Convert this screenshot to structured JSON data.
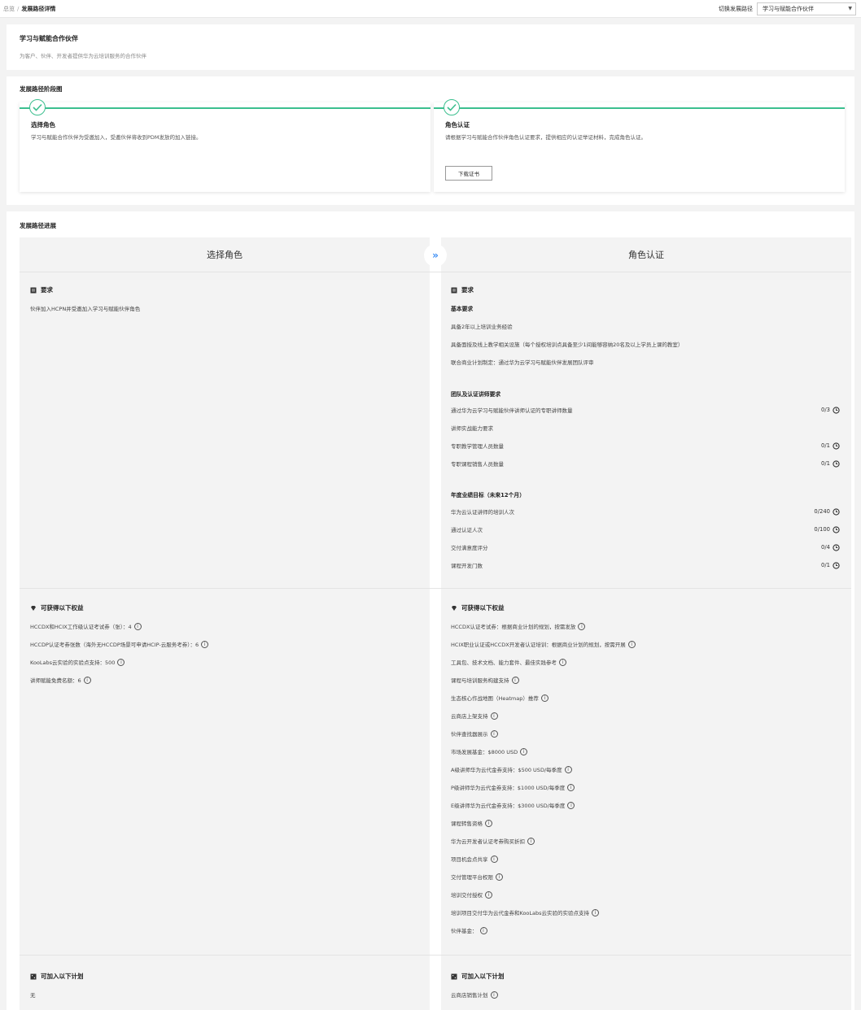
{
  "breadcrumb": {
    "root": "总览",
    "sep": "/",
    "current": "发展路径详情"
  },
  "switcher": {
    "label": "切换发展路径",
    "selected": "学习与赋能合作伙伴"
  },
  "header": {
    "title": "学习与赋能合作伙伴",
    "desc": "为客户、伙伴、开发者提供华为云培训服务的合作伙伴"
  },
  "stage_map": {
    "title": "发展路径阶段图",
    "stages": [
      {
        "title": "选择角色",
        "desc": "学习与赋能合作伙伴为受邀加入，受邀伙伴将收到PDM发放的加入链接。"
      },
      {
        "title": "角色认证",
        "desc": "请根据学习与赋能合作伙伴角色认证要求，提供相应的认证举证材料，完成角色认证。",
        "button": "下载证书"
      }
    ]
  },
  "progress": {
    "title": "发展路径进展",
    "left_col": "选择角色",
    "right_col": "角色认证",
    "requirements_title": "要求",
    "left_requirements": [
      "伙伴加入HCPN并受邀加入学习与赋能伙伴角色"
    ],
    "right_requirements": {
      "basic_title": "基本要求",
      "basic": [
        "具备2年以上培训业务经验",
        "具备面授及线上教学相关设施（每个授权培训点具备至少1间能够容纳20名及以上学员上课的教室）",
        "联合商业计划制定：通过华为云学习与赋能伙伴发展团队评审"
      ],
      "team_title": "团队及认证讲师要求",
      "team": [
        {
          "label": "通过华为云学习与赋能伙伴讲师认证的专职讲师数量",
          "count": "0/3"
        },
        {
          "label": "讲师实战能力要求",
          "count": ""
        },
        {
          "label": "专职教学管理人员数量",
          "count": "0/1"
        },
        {
          "label": "专职课程销售人员数量",
          "count": "0/1"
        }
      ],
      "annual_title": "年度业绩目标（未来12个月）",
      "annual": [
        {
          "label": "华为云认证讲师的培训人次",
          "count": "0/240"
        },
        {
          "label": "通过认证人次",
          "count": "0/100"
        },
        {
          "label": "交付满意度评分",
          "count": "0/4"
        },
        {
          "label": "课程开发门数",
          "count": "0/1"
        }
      ]
    },
    "benefits_title": "可获得以下权益",
    "left_benefits": [
      "HCCDX和HCIX工作级认证考试券（张）：4",
      "HCCDP认证考券张数（海外无HCCDP场景可申请HCIP-云服务考券）：6",
      "KooLabs云实验的实验点支持：500",
      "讲师赋能免费名额：6"
    ],
    "right_benefits": [
      "HCCDX认证考试券：根据商业计划的规划，按需发放",
      "HCIX职业认证或HCCDX开发者认证培训：根据商业计划的规划，按需开展",
      "工具包、技术文档、能力套件、最佳实践参考",
      "课程与培训服务构建支持",
      "生态核心作战地图（Heatmap）推荐",
      "云商店上架支持",
      "伙伴查找器展示",
      "市场发展基金：$8000 USD",
      "A级讲师华为云代金券支持：$500 USD/每季度",
      "P级讲师华为云代金券支持：$1000 USD/每季度",
      "E级讲师华为云代金券支持：$3000 USD/每季度",
      "课程转售资格",
      "华为云开发者认证考券购买折扣",
      "项目机会点共享",
      "交付管理平台权限",
      "培训交付授权",
      "培训项目交付华为云代金券和KooLabs云实验的实验点支持",
      "伙伴基金："
    ],
    "plans_title": "可加入以下计划",
    "left_plans": [
      "无"
    ],
    "right_plans": [
      "云商店销售计划"
    ],
    "info_glyph": "i"
  },
  "colors": {
    "accent": "#3cbf8f",
    "arrow": "#3a8df5"
  }
}
